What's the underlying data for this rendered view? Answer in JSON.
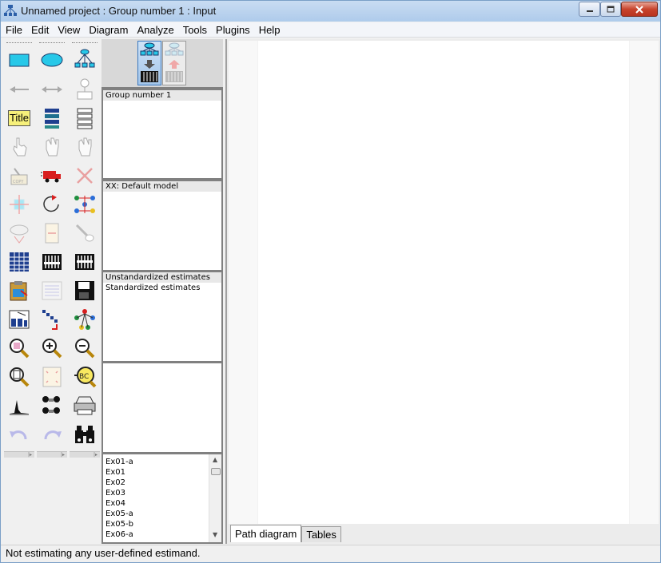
{
  "window": {
    "title": "Unnamed project : Group number 1 : Input"
  },
  "menu": [
    "File",
    "Edit",
    "View",
    "Diagram",
    "Analyze",
    "Tools",
    "Plugins",
    "Help"
  ],
  "toolbox": {
    "title_tool_label": "Title",
    "icons": [
      [
        "rectangle-observed-variable-icon",
        "ellipse-unobserved-variable-icon",
        "latent-variable-indicators-icon"
      ],
      [
        "single-arrow-path-icon",
        "double-arrow-covariance-icon",
        "unique-variable-icon"
      ],
      [
        "figure-caption-icon",
        "list-model-variables-icon",
        "list-dataset-variables-icon"
      ],
      [
        "select-one-object-icon",
        "select-all-objects-icon",
        "deselect-all-icon"
      ],
      [
        "duplicate-objects-icon",
        "move-objects-icon",
        "erase-objects-icon"
      ],
      [
        "change-shape-icon",
        "rotate-indicators-icon",
        "reflect-indicators-icon"
      ],
      [
        "move-parameter-values-icon",
        "scroll-icon",
        "touch-up-icon"
      ],
      [
        "select-data-files-icon",
        "analysis-properties-icon",
        "calculate-estimates-icon"
      ],
      [
        "copy-to-clipboard-icon",
        "view-text-icon",
        "save-diagram-icon"
      ],
      [
        "object-properties-icon",
        "drag-properties-icon",
        "preserve-symmetries-icon"
      ],
      [
        "zoom-in-area-icon",
        "zoom-in-icon",
        "zoom-out-icon"
      ],
      [
        "show-page-icon",
        "resize-diagram-icon",
        "magnify-glass-icon"
      ],
      [
        "bayesian-estimation-icon",
        "multiple-group-analysis-icon",
        "print-diagram-icon"
      ],
      [
        "undo-icon",
        "redo-icon",
        "specification-search-icon"
      ]
    ]
  },
  "panels": {
    "groups": [
      "Group number 1"
    ],
    "models": [
      "XX: Default model"
    ],
    "estimates": [
      "Unstandardized estimates",
      "Standardized estimates"
    ],
    "files": [
      "Ex01-a",
      "Ex01",
      "Ex02",
      "Ex03",
      "Ex04",
      "Ex05-a",
      "Ex05-b",
      "Ex06-a"
    ]
  },
  "tabs": [
    {
      "label": "Path diagram",
      "active": true
    },
    {
      "label": "Tables",
      "active": false
    }
  ],
  "status": "Not estimating any user-defined estimand.",
  "colors": {
    "accent": "#3a78c0",
    "close_button": "#c8442d",
    "rectangle_tool": "#27c8e8"
  }
}
